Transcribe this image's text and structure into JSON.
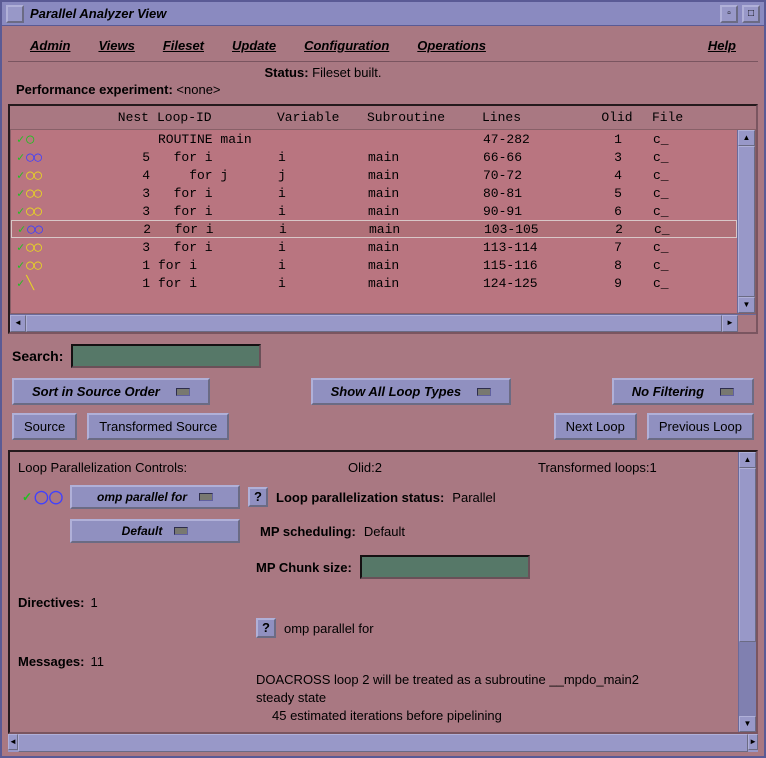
{
  "window": {
    "title": "Parallel Analyzer View"
  },
  "menu": {
    "admin": "Admin",
    "views": "Views",
    "fileset": "Fileset",
    "update": "Update",
    "configuration": "Configuration",
    "operations": "Operations",
    "help": "Help"
  },
  "status": {
    "status_label": "Status:",
    "status_value": "Fileset built.",
    "perf_label": "Performance experiment:",
    "perf_value": "<none>"
  },
  "table": {
    "headers": {
      "nest": "Nest",
      "loopid": "Loop-ID",
      "variable": "Variable",
      "subroutine": "Subroutine",
      "lines": "Lines",
      "olid": "Olid",
      "file": "File"
    },
    "rows": [
      {
        "icon": "circle-green",
        "nest": "",
        "loopid": "ROUTINE main",
        "variable": "",
        "subroutine": "",
        "lines": "47-282",
        "olid": "1",
        "file": "c_",
        "selected": false
      },
      {
        "icon": "loop-blue",
        "nest": "5",
        "loopid": "  for i",
        "variable": "i",
        "subroutine": "main",
        "lines": "66-66",
        "olid": "3",
        "file": "c_",
        "selected": false
      },
      {
        "icon": "loop-yellow",
        "nest": "4",
        "loopid": "    for j",
        "variable": "j",
        "subroutine": "main",
        "lines": "70-72",
        "olid": "4",
        "file": "c_",
        "selected": false
      },
      {
        "icon": "loop-yellow",
        "nest": "3",
        "loopid": "  for i",
        "variable": "i",
        "subroutine": "main",
        "lines": "80-81",
        "olid": "5",
        "file": "c_",
        "selected": false
      },
      {
        "icon": "loop-yellow",
        "nest": "3",
        "loopid": "  for i",
        "variable": "i",
        "subroutine": "main",
        "lines": "90-91",
        "olid": "6",
        "file": "c_",
        "selected": false
      },
      {
        "icon": "loop-blue",
        "nest": "2",
        "loopid": "  for i",
        "variable": "i",
        "subroutine": "main",
        "lines": "103-105",
        "olid": "2",
        "file": "c_",
        "selected": true
      },
      {
        "icon": "loop-yellow",
        "nest": "3",
        "loopid": "  for i",
        "variable": "i",
        "subroutine": "main",
        "lines": "113-114",
        "olid": "7",
        "file": "c_",
        "selected": false
      },
      {
        "icon": "loop-yellow",
        "nest": "1",
        "loopid": "for i",
        "variable": "i",
        "subroutine": "main",
        "lines": "115-116",
        "olid": "8",
        "file": "c_",
        "selected": false
      },
      {
        "icon": "line-yellow",
        "nest": "1",
        "loopid": "for i",
        "variable": "i",
        "subroutine": "main",
        "lines": "124-125",
        "olid": "9",
        "file": "c_",
        "selected": false
      }
    ]
  },
  "search": {
    "label": "Search:"
  },
  "options": {
    "sort": "Sort in Source Order",
    "show": "Show All Loop Types",
    "filter": "No Filtering"
  },
  "buttons": {
    "source": "Source",
    "transformed": "Transformed Source",
    "next_loop": "Next Loop",
    "prev_loop": "Previous Loop"
  },
  "controls": {
    "header": "Loop Parallelization Controls:",
    "olid_label": "Olid:",
    "olid_val": "2",
    "tloops_label": "Transformed loops:",
    "tloops_val": "1",
    "omp_opt": "omp parallel for",
    "default_opt": "Default",
    "status_label": "Loop parallelization status:",
    "status_val": "Parallel",
    "sched_label": "MP scheduling:",
    "sched_val": "Default",
    "chunk_label": "MP Chunk size:",
    "directives_label": "Directives:",
    "directives_count": "1",
    "directive_text": "omp parallel for",
    "messages_label": "Messages:",
    "messages_count": "11",
    "msg1": "DOACROSS loop 2 will be treated as a subroutine __mpdo_main2",
    "msg2": "steady state",
    "msg3": "45 estimated iterations before pipelining"
  }
}
